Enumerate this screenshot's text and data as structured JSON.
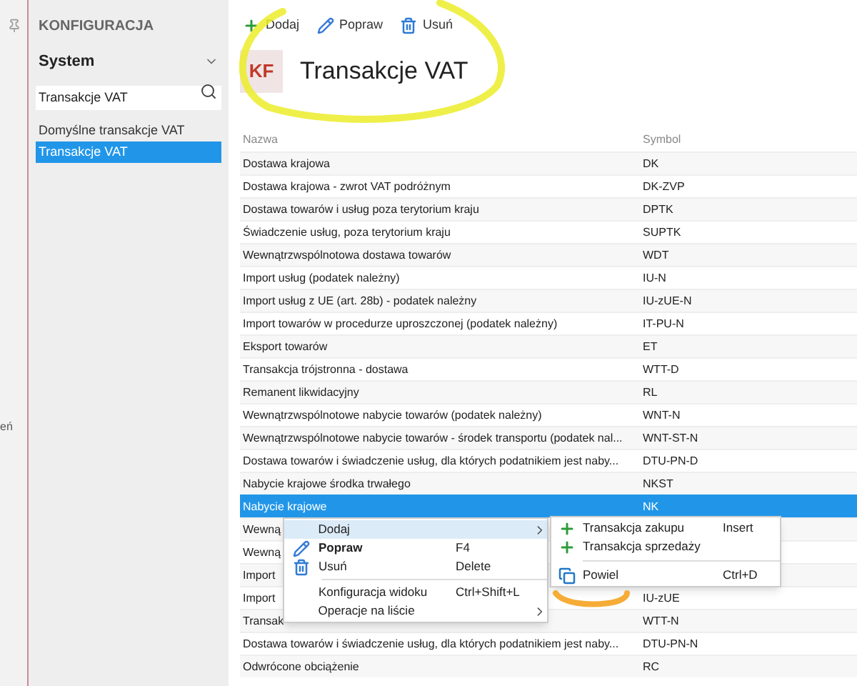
{
  "side_strip": {
    "fragment": "eń"
  },
  "sidebar": {
    "title": "KONFIGURACJA",
    "dropdown": "System",
    "search": {
      "value": "Transakcje VAT"
    },
    "items": [
      {
        "label": "Domyślne transakcje VAT",
        "selected": false
      },
      {
        "label": "Transakcje VAT",
        "selected": true
      }
    ]
  },
  "toolbar": [
    {
      "kind": "add",
      "label": "Dodaj"
    },
    {
      "kind": "edit",
      "label": "Popraw"
    },
    {
      "kind": "delete",
      "label": "Usuń"
    }
  ],
  "header": {
    "badge": "KF",
    "title": "Transakcje VAT"
  },
  "table": {
    "columns": [
      "Nazwa",
      "Symbol"
    ],
    "rows": [
      {
        "name": "Dostawa krajowa",
        "symbol": "DK",
        "selected": false
      },
      {
        "name": "Dostawa krajowa - zwrot VAT podróżnym",
        "symbol": "DK-ZVP",
        "selected": false
      },
      {
        "name": "Dostawa towarów i usług poza terytorium kraju",
        "symbol": "DPTK",
        "selected": false
      },
      {
        "name": "Świadczenie usług, poza terytorium kraju",
        "symbol": "SUPTK",
        "selected": false
      },
      {
        "name": "Wewnątrzwspólnotowa dostawa towarów",
        "symbol": "WDT",
        "selected": false
      },
      {
        "name": "Import usług (podatek należny)",
        "symbol": "IU-N",
        "selected": false
      },
      {
        "name": "Import usług z UE (art. 28b) - podatek należny",
        "symbol": "IU-zUE-N",
        "selected": false
      },
      {
        "name": "Import towarów w procedurze uproszczonej (podatek należny)",
        "symbol": "IT-PU-N",
        "selected": false
      },
      {
        "name": "Eksport towarów",
        "symbol": "ET",
        "selected": false
      },
      {
        "name": "Transakcja trójstronna - dostawa",
        "symbol": "WTT-D",
        "selected": false
      },
      {
        "name": "Remanent likwidacyjny",
        "symbol": "RL",
        "selected": false
      },
      {
        "name": "Wewnątrzwspólnotowe nabycie towarów (podatek należny)",
        "symbol": "WNT-N",
        "selected": false
      },
      {
        "name": "Wewnątrzwspólnotowe nabycie towarów - środek transportu (podatek nal...",
        "symbol": "WNT-ST-N",
        "selected": false
      },
      {
        "name": "Dostawa towarów i świadczenie usług, dla których podatnikiem jest naby...",
        "symbol": "DTU-PN-D",
        "selected": false
      },
      {
        "name": "Nabycie krajowe środka trwałego",
        "symbol": "NKST",
        "selected": false
      },
      {
        "name": "Nabycie krajowe",
        "symbol": "NK",
        "selected": true
      },
      {
        "name": "Wewną",
        "selected": false
      },
      {
        "name": "Wewną",
        "selected": false
      },
      {
        "name": "Import",
        "selected": false
      },
      {
        "name": "Import",
        "symbol": "IU-zUE",
        "selected": false
      },
      {
        "name": "Transak",
        "symbol": "WTT-N",
        "selected": false
      },
      {
        "name": "Dostawa towarów i świadczenie usług, dla których podatnikiem jest naby...",
        "symbol": "DTU-PN-N",
        "selected": false
      },
      {
        "name": "Odwrócone obciążenie",
        "symbol": "RC",
        "selected": false
      }
    ]
  },
  "context_menu": [
    {
      "kind": "submenu",
      "label": "Dodaj",
      "selected": true
    },
    {
      "kind": "edit",
      "label": "Popraw",
      "shortcut": "F4",
      "selected": false
    },
    {
      "kind": "delete",
      "label": "Usuń",
      "shortcut": "Delete",
      "selected": false
    },
    {
      "kind": "separator"
    },
    {
      "kind": "plain",
      "label": "Konfiguracja widoku",
      "shortcut": "Ctrl+Shift+L",
      "selected": false
    },
    {
      "kind": "submenu",
      "label": "Operacje na liście",
      "selected": false
    }
  ],
  "submenu": [
    {
      "kind": "add",
      "label": "Transakcja zakupu",
      "shortcut": "Insert"
    },
    {
      "kind": "add",
      "label": "Transakcja sprzedaży"
    },
    {
      "kind": "separator"
    },
    {
      "kind": "copy",
      "label": "Powiel",
      "shortcut": "Ctrl+D"
    }
  ]
}
